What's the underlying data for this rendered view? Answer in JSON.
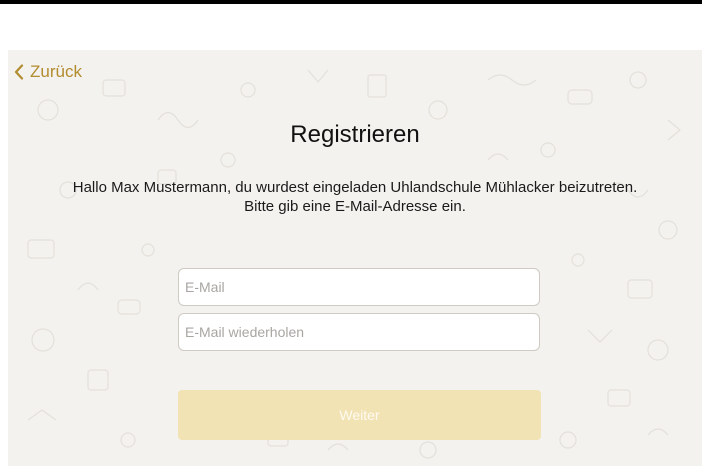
{
  "nav": {
    "back_label": "Zurück",
    "back_icon": "chevron-left-icon"
  },
  "title": "Registrieren",
  "description": {
    "greeting": "Hallo ",
    "user_name": "Max Mustermann",
    "invited_text": ", du wurdest eingeladen ",
    "school_name": "Uhlandschule Mühlacker",
    "join_text": " beizutreten.",
    "prompt": "Bitte gib eine E-Mail-Adresse ein."
  },
  "form": {
    "email_placeholder": "E-Mail",
    "email_value": "",
    "email_repeat_placeholder": "E-Mail wiederholen",
    "email_repeat_value": "",
    "submit_label": "Weiter",
    "submit_enabled": false
  },
  "colors": {
    "accent": "#b28c2e",
    "button_disabled": "#f2e3b5",
    "background": "#f4f2ef"
  }
}
